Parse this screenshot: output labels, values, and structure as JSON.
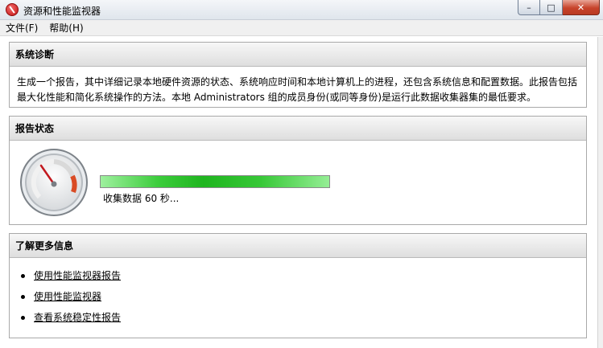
{
  "window": {
    "title": "资源和性能监视器",
    "minimize_glyph": "–",
    "maximize_glyph": "□",
    "close_glyph": "✕"
  },
  "menu": {
    "file": "文件(F)",
    "help": "帮助(H)"
  },
  "diagnostics": {
    "header": "系统诊断",
    "description": "生成一个报告，其中详细记录本地硬件资源的状态、系统响应时间和本地计算机上的进程，还包含系统信息和配置数据。此报告包括最大化性能和简化系统操作的方法。本地 Administrators 组的成员身份(或同等身份)是运行此数据收集器集的最低要求。"
  },
  "report_status": {
    "header": "报告状态",
    "gauge_icon": "performance-gauge-icon",
    "progress": 1.0,
    "progress_text": "收集数据 60 秒..."
  },
  "learn_more": {
    "header": "了解更多信息",
    "links": [
      "使用性能监视器报告",
      "使用性能监视器",
      "查看系统稳定性报告"
    ]
  },
  "colors": {
    "progress_green": "#1fb51f",
    "close_red": "#c7432b",
    "gauge_needle": "#c2191f"
  }
}
